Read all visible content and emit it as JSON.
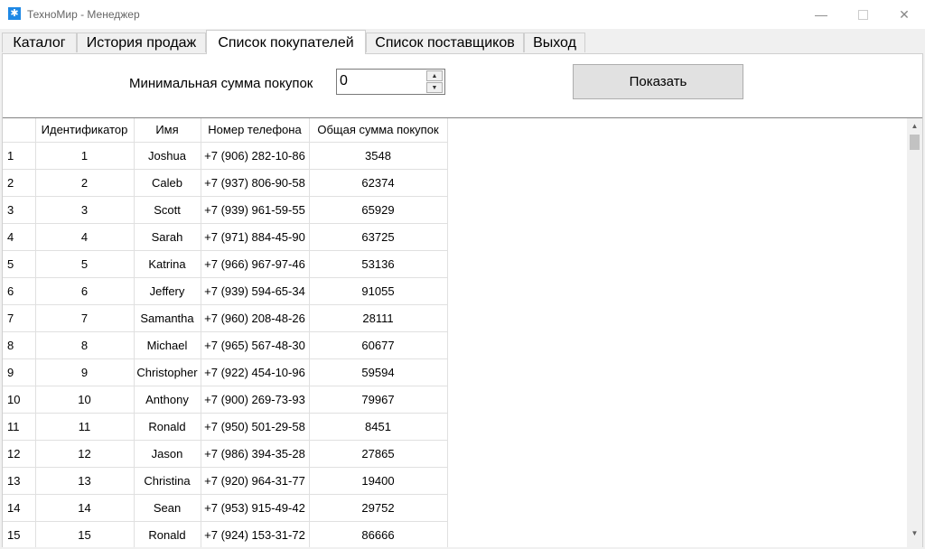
{
  "window": {
    "title": "ТехноМир - Менеджер",
    "icon": "snowflake-app-icon",
    "minimize_glyph": "—",
    "close_glyph": "✕"
  },
  "tabs": [
    {
      "label": "Каталог"
    },
    {
      "label": "История продаж"
    },
    {
      "label": "Список покупателей"
    },
    {
      "label": "Список поставщиков"
    },
    {
      "label": "Выход"
    }
  ],
  "filter": {
    "label": "Минимальная сумма покупок",
    "value": "0",
    "show_button": "Показать"
  },
  "grid": {
    "columns": [
      "Идентификатор",
      "Имя",
      "Номер телефона",
      "Общая сумма покупок"
    ],
    "rows": [
      {
        "n": "1",
        "id": "1",
        "name": "Joshua",
        "phone": "+7 (906) 282-10-86",
        "total": "3548"
      },
      {
        "n": "2",
        "id": "2",
        "name": "Caleb",
        "phone": "+7 (937) 806-90-58",
        "total": "62374"
      },
      {
        "n": "3",
        "id": "3",
        "name": "Scott",
        "phone": "+7 (939) 961-59-55",
        "total": "65929"
      },
      {
        "n": "4",
        "id": "4",
        "name": "Sarah",
        "phone": "+7 (971) 884-45-90",
        "total": "63725"
      },
      {
        "n": "5",
        "id": "5",
        "name": "Katrina",
        "phone": "+7 (966) 967-97-46",
        "total": "53136"
      },
      {
        "n": "6",
        "id": "6",
        "name": "Jeffery",
        "phone": "+7 (939) 594-65-34",
        "total": "91055"
      },
      {
        "n": "7",
        "id": "7",
        "name": "Samantha",
        "phone": "+7 (960) 208-48-26",
        "total": "28111"
      },
      {
        "n": "8",
        "id": "8",
        "name": "Michael",
        "phone": "+7 (965) 567-48-30",
        "total": "60677"
      },
      {
        "n": "9",
        "id": "9",
        "name": "Christopher",
        "phone": "+7 (922) 454-10-96",
        "total": "59594"
      },
      {
        "n": "10",
        "id": "10",
        "name": "Anthony",
        "phone": "+7 (900) 269-73-93",
        "total": "79967"
      },
      {
        "n": "11",
        "id": "11",
        "name": "Ronald",
        "phone": "+7 (950) 501-29-58",
        "total": "8451"
      },
      {
        "n": "12",
        "id": "12",
        "name": "Jason",
        "phone": "+7 (986) 394-35-28",
        "total": "27865"
      },
      {
        "n": "13",
        "id": "13",
        "name": "Christina",
        "phone": "+7 (920) 964-31-77",
        "total": "19400"
      },
      {
        "n": "14",
        "id": "14",
        "name": "Sean",
        "phone": "+7 (953) 915-49-42",
        "total": "29752"
      },
      {
        "n": "15",
        "id": "15",
        "name": "Ronald",
        "phone": "+7 (924) 153-31-72",
        "total": "86666"
      }
    ]
  },
  "colors": {
    "accent": "#1e88e5",
    "button_face": "#e1e1e1",
    "grid_line": "#e0e0e0"
  }
}
